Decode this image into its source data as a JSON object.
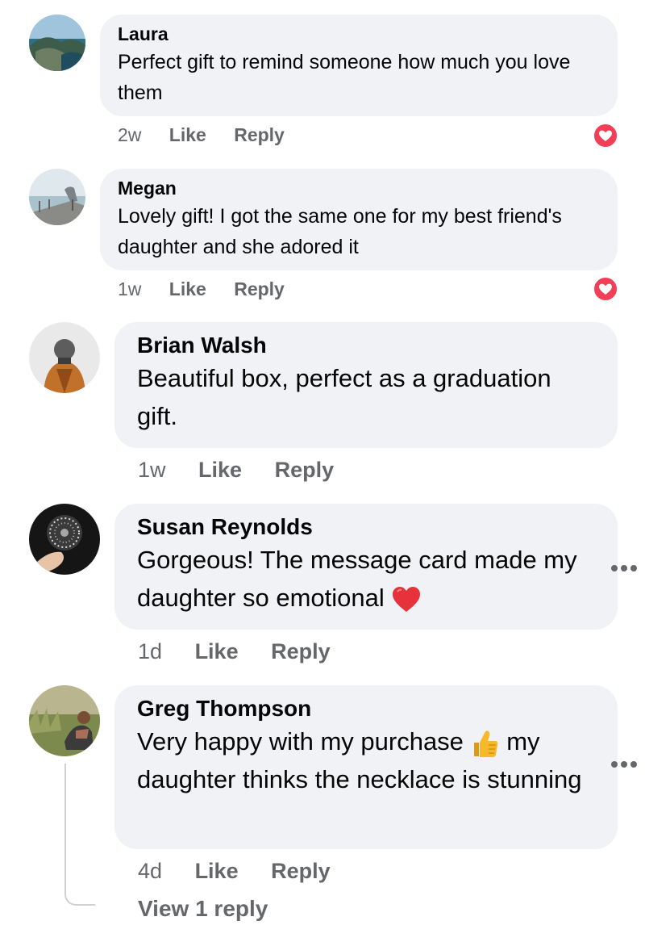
{
  "comments": [
    {
      "author": "Laura",
      "text": "Perfect gift to remind someone how much you love them",
      "time": "2w",
      "like_label": "Like",
      "reply_label": "Reply",
      "reaction": "heart-icon"
    },
    {
      "author": "Megan",
      "text": "Lovely gift! I got the same one for my best friend's daughter and she adored it",
      "time": "1w",
      "like_label": "Like",
      "reply_label": "Reply",
      "reaction": "heart-icon"
    },
    {
      "author": "Brian Walsh",
      "text": "Beautiful box, perfect as a graduation gift.",
      "time": "1w",
      "like_label": "Like",
      "reply_label": "Reply"
    },
    {
      "author": "Susan Reynolds",
      "text_before_emoji": "Gorgeous! The message card made my daughter so emotional",
      "emoji": "red-heart-emoji",
      "time": "1d",
      "like_label": "Like",
      "reply_label": "Reply",
      "menu": "more-options-icon"
    },
    {
      "author": "Greg Thompson",
      "text_before_emoji": "Very happy with my purchase",
      "emoji": "thumbs-up-emoji",
      "text_after_emoji": "my daughter thinks the necklace is stunning",
      "time": "4d",
      "like_label": "Like",
      "reply_label": "Reply",
      "menu": "more-options-icon",
      "view_replies_label": "View 1 reply"
    }
  ],
  "colors": {
    "bubble": "#f0f2f5",
    "meta_text": "#65676b",
    "reaction_heart": "#f33e58",
    "thread_line": "#ced0d4"
  }
}
